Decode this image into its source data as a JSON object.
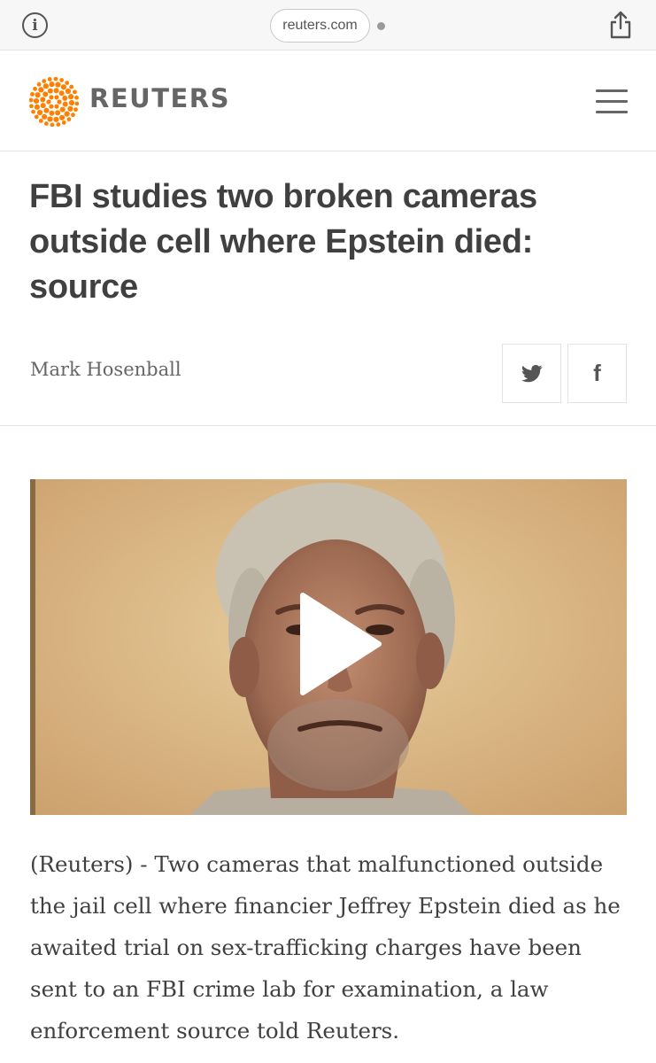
{
  "browser": {
    "url": "reuters.com",
    "info_icon": "info-icon",
    "share_icon": "share-icon"
  },
  "site": {
    "brand": "REUTERS",
    "logo_icon": "reuters-dot-logo",
    "menu_icon": "hamburger-menu-icon",
    "accent_color": "#ff8000"
  },
  "article": {
    "headline": "FBI studies two broken cameras outside cell where Epstein died: source",
    "author": "Mark Hosenball",
    "share": {
      "twitter_icon": "twitter-icon",
      "facebook_icon": "facebook-icon",
      "facebook_glyph": "f"
    },
    "video": {
      "play_icon": "play-icon"
    },
    "lead": "(Reuters) - Two cameras that malfunctioned outside the jail cell where financier Jeffrey Epstein died as he awaited trial on sex-trafficking charges have been sent to an FBI crime lab for examination, a law enforcement source told Reuters."
  }
}
